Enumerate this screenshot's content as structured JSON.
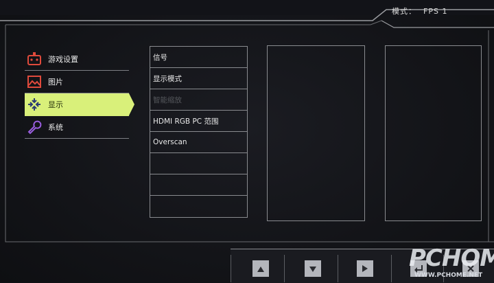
{
  "header": {
    "mode_label": "模式：",
    "mode_value": "FPS 1"
  },
  "menu": {
    "items": [
      {
        "label": "游戏设置",
        "icon": "gamepad-icon",
        "active": false
      },
      {
        "label": "图片",
        "icon": "picture-icon",
        "active": false
      },
      {
        "label": "显示",
        "icon": "display-arrows-icon",
        "active": true
      },
      {
        "label": "系统",
        "icon": "wrench-icon",
        "active": false
      }
    ]
  },
  "submenu": {
    "items": [
      {
        "label": "信号",
        "dim": false
      },
      {
        "label": "显示模式",
        "dim": false
      },
      {
        "label": "智能缩放",
        "dim": true
      },
      {
        "label": "HDMI RGB PC 范围",
        "dim": false
      },
      {
        "label": "Overscan",
        "dim": false
      },
      {
        "label": "",
        "dim": false
      },
      {
        "label": "",
        "dim": false
      },
      {
        "label": "",
        "dim": false
      }
    ]
  },
  "buttons": [
    "up-arrow-icon",
    "down-arrow-icon",
    "right-arrow-icon",
    "return-icon",
    "close-icon"
  ],
  "colors": {
    "accent": "#d9f07a",
    "icon_red": "#e04a3c",
    "icon_purple": "#9a5ee0",
    "frame": "#9a9ca0"
  },
  "watermark": {
    "brand": "PCHOME",
    "url": "WWW.PCHOME.NET"
  }
}
